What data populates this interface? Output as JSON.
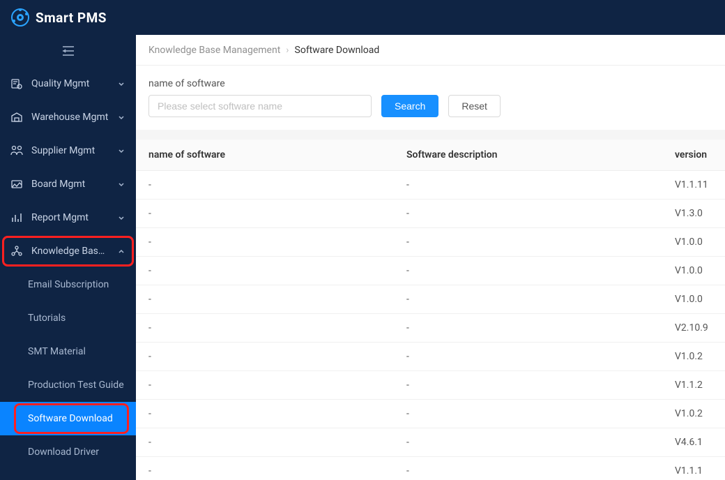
{
  "brand": {
    "name": "Smart PMS"
  },
  "sidebar": {
    "items": [
      {
        "label": "Quality Mgmt",
        "icon": "quality",
        "expandable": true,
        "expanded": false
      },
      {
        "label": "Warehouse Mgmt",
        "icon": "warehouse",
        "expandable": true,
        "expanded": false
      },
      {
        "label": "Supplier Mgmt",
        "icon": "supplier",
        "expandable": true,
        "expanded": false
      },
      {
        "label": "Board Mgmt",
        "icon": "board",
        "expandable": true,
        "expanded": false
      },
      {
        "label": "Report Mgmt",
        "icon": "report",
        "expandable": true,
        "expanded": false
      },
      {
        "label": "Knowledge Base …",
        "icon": "knowledge",
        "expandable": true,
        "expanded": true,
        "highlighted": true,
        "children": [
          {
            "label": "Email Subscription"
          },
          {
            "label": "Tutorials"
          },
          {
            "label": "SMT Material"
          },
          {
            "label": "Production Test Guide"
          },
          {
            "label": "Software Download",
            "active": true,
            "highlighted": true
          },
          {
            "label": "Download Driver"
          }
        ]
      }
    ]
  },
  "breadcrumb": {
    "parent": "Knowledge Base Management",
    "current": "Software Download"
  },
  "filters": {
    "label": "name of software",
    "placeholder": "Please select software name",
    "search_label": "Search",
    "reset_label": "Reset"
  },
  "table": {
    "headers": [
      "name of software",
      "Software description",
      "version"
    ],
    "rows": [
      {
        "name": "-",
        "desc": "-",
        "version": "V1.1.11"
      },
      {
        "name": "-",
        "desc": "-",
        "version": "V1.3.0"
      },
      {
        "name": "-",
        "desc": "-",
        "version": "V1.0.0"
      },
      {
        "name": "-",
        "desc": "-",
        "version": "V1.0.0"
      },
      {
        "name": "-",
        "desc": "-",
        "version": "V1.0.0"
      },
      {
        "name": "-",
        "desc": "-",
        "version": "V2.10.9"
      },
      {
        "name": "-",
        "desc": "-",
        "version": "V1.0.2"
      },
      {
        "name": "-",
        "desc": "-",
        "version": "V1.1.2"
      },
      {
        "name": "-",
        "desc": "-",
        "version": "V1.0.2"
      },
      {
        "name": "-",
        "desc": "-",
        "version": "V4.6.1"
      },
      {
        "name": "-",
        "desc": "-",
        "version": "V1.1.1"
      }
    ]
  }
}
